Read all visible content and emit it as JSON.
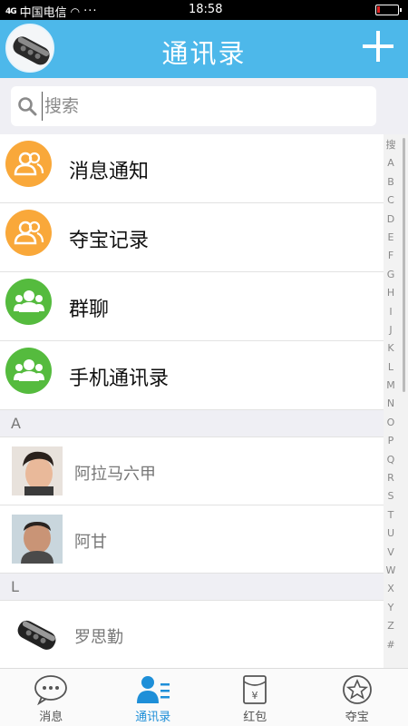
{
  "status_bar": {
    "signal": "4G",
    "carrier": "中国电信",
    "dots": "···",
    "time": "18:58",
    "battery_level": 0.12
  },
  "header": {
    "title": "通讯录",
    "add_icon": "plus-icon",
    "background": "#4db8ea"
  },
  "search": {
    "placeholder": "搜索"
  },
  "function_rows": [
    {
      "label": "消息通知",
      "icon": "user-group-icon",
      "color": "#f9a83a"
    },
    {
      "label": "夺宝记录",
      "icon": "user-group-icon",
      "color": "#f9a83a"
    },
    {
      "label": "群聊",
      "icon": "group-icon",
      "color": "#55bb3e"
    },
    {
      "label": "手机通讯录",
      "icon": "group-icon",
      "color": "#55bb3e"
    }
  ],
  "sections": [
    {
      "letter": "A",
      "contacts": [
        {
          "name": "阿拉马六甲",
          "avatar": "person-photo-1"
        },
        {
          "name": "阿甘",
          "avatar": "person-photo-2"
        }
      ]
    },
    {
      "letter": "L",
      "contacts": [
        {
          "name": "罗思勤",
          "avatar": "car-key-photo"
        }
      ]
    }
  ],
  "index_letters": [
    "搜",
    "A",
    "B",
    "C",
    "D",
    "E",
    "F",
    "G",
    "H",
    "I",
    "J",
    "K",
    "L",
    "M",
    "N",
    "O",
    "P",
    "Q",
    "R",
    "S",
    "T",
    "U",
    "V",
    "W",
    "X",
    "Y",
    "Z",
    "#"
  ],
  "tabs": [
    {
      "label": "消息",
      "icon": "chat-bubble-icon",
      "active": false
    },
    {
      "label": "通讯录",
      "icon": "contacts-icon",
      "active": true
    },
    {
      "label": "红包",
      "icon": "red-envelope-icon",
      "active": false
    },
    {
      "label": "夺宝",
      "icon": "star-icon",
      "active": false
    }
  ],
  "colors": {
    "accent": "#4db8ea",
    "active_tab": "#1e8fd8",
    "orange": "#f9a83a",
    "green": "#55bb3e"
  }
}
